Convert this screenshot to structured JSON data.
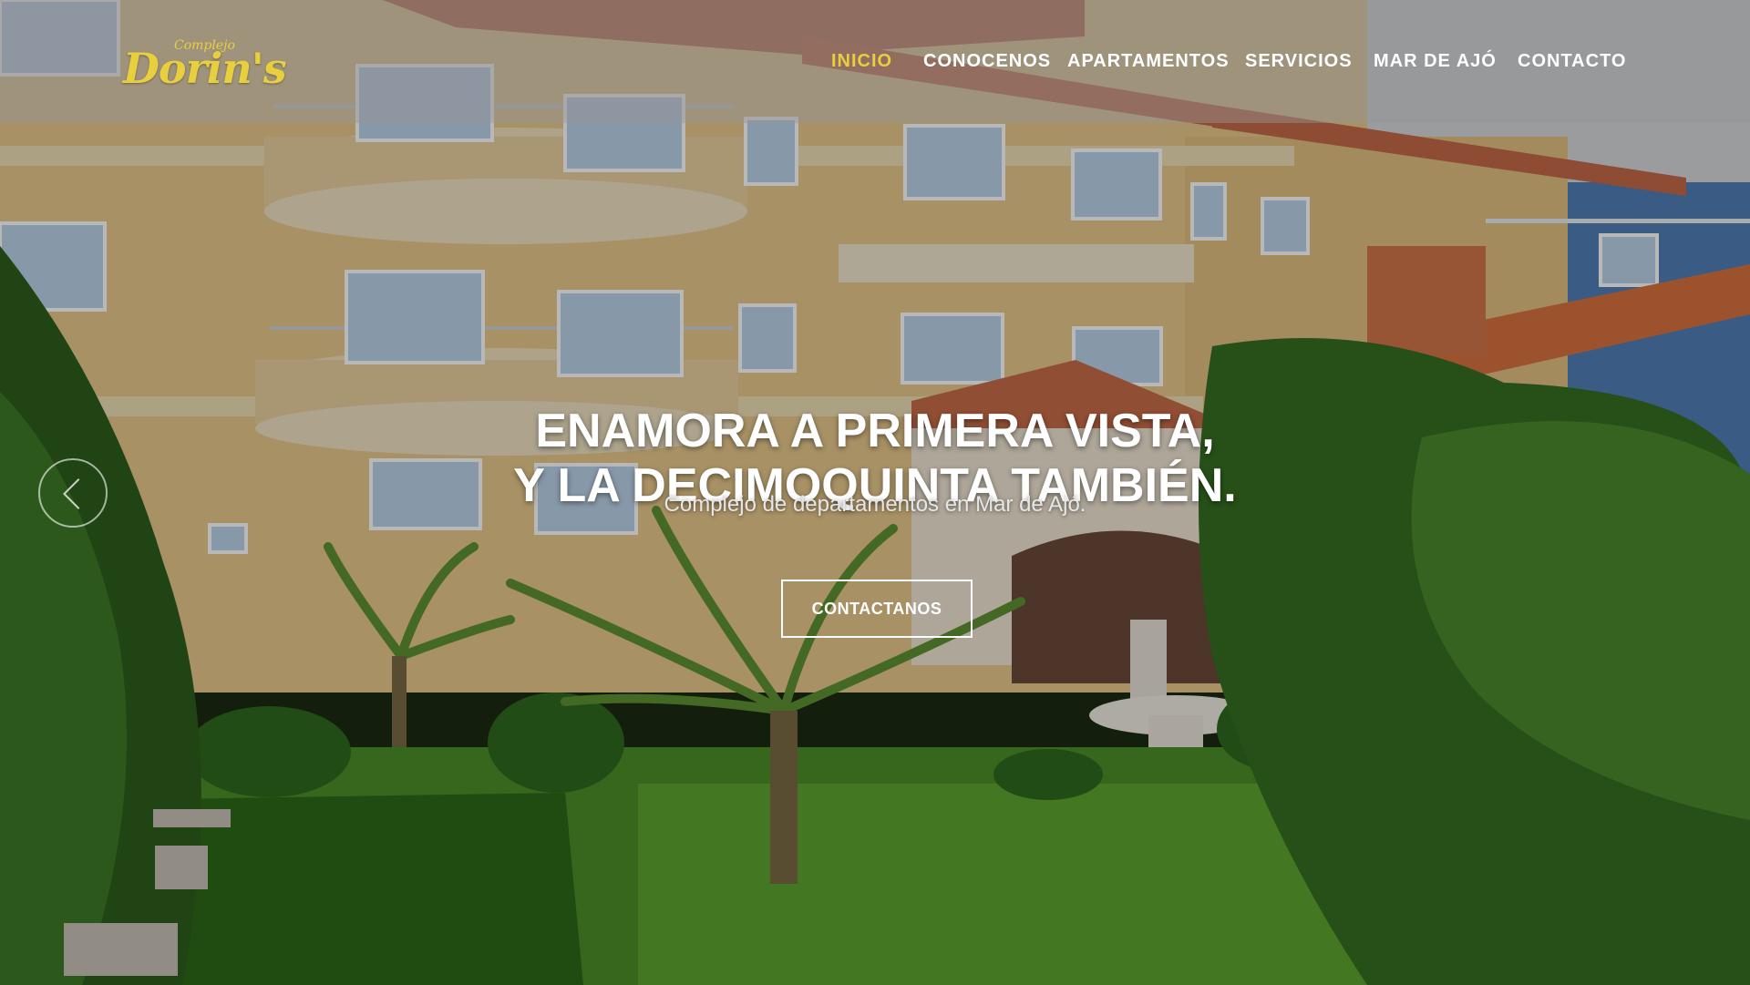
{
  "logo": {
    "small_text": "Complejo",
    "main_text": "Dorin's",
    "color": "#e7cf3e"
  },
  "nav": {
    "items": [
      {
        "label": "INICIO",
        "active": true
      },
      {
        "label": "CONOCENOS",
        "active": false
      },
      {
        "label": "APARTAMENTOS",
        "active": false
      },
      {
        "label": "SERVICIOS",
        "active": false
      },
      {
        "label": "MAR DE AJÓ",
        "active": false
      },
      {
        "label": "CONTACTO",
        "active": false
      }
    ],
    "active_color": "#e7cf3e",
    "text_color": "#ffffff"
  },
  "hero": {
    "headline_line1": "ENAMORA A PRIMERA VISTA,",
    "headline_line2": "Y LA DECIMOQUINTA TAMBIÉN.",
    "subtitle": "Complejo de departamentos en Mar de Ajó.",
    "cta_label": "CONTACTANOS",
    "prev_icon": "chevron-left-icon"
  }
}
